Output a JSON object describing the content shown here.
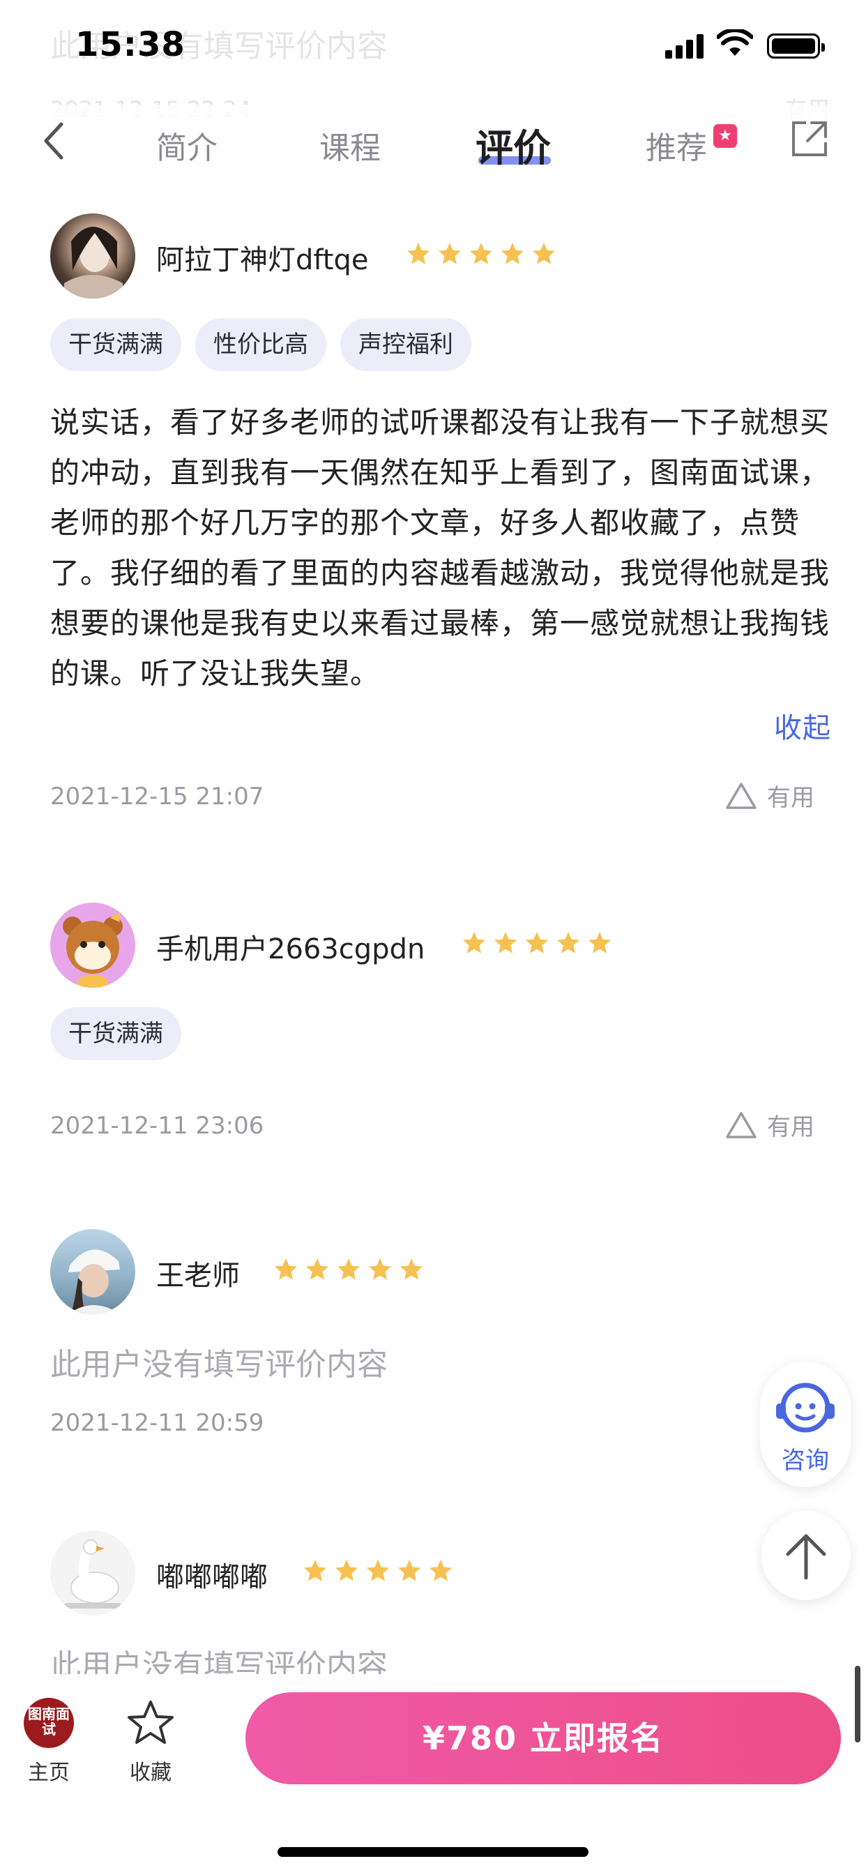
{
  "status_bar": {
    "time": "15:38"
  },
  "background_ghost": {
    "text": "此用户没有填写评价内容",
    "date": "2021-12-15 22:24",
    "useful": "有用"
  },
  "header": {
    "tabs": [
      {
        "label": "简介",
        "active": false
      },
      {
        "label": "课程",
        "active": false
      },
      {
        "label": "评价",
        "active": true
      },
      {
        "label": "推荐",
        "active": false
      }
    ],
    "badge_icon": "star-badge"
  },
  "reviews": [
    {
      "name": "阿拉丁神灯dftqe",
      "rating": 5,
      "tags": [
        "干货满满",
        "性价比高",
        "声控福利"
      ],
      "content": "说实话，看了好多老师的试听课都没有让我有一下子就想买的冲动，直到我有一天偶然在知乎上看到了，图南面试课，老师的那个好几万字的那个文章，好多人都收藏了，点赞了。我仔细的看了里面的内容越看越激动，我觉得他就是我想要的课他是我有史以来看过最棒，第一感觉就想让我掏钱的课。听了没让我失望。",
      "collapse_label": "收起",
      "date": "2021-12-15 21:07",
      "useful_label": "有用"
    },
    {
      "name": "手机用户2663cgpdn",
      "rating": 5,
      "tags": [
        "干货满满"
      ],
      "date": "2021-12-11 23:06",
      "useful_label": "有用"
    },
    {
      "name": "王老师",
      "rating": 5,
      "empty_text": "此用户没有填写评价内容",
      "date": "2021-12-11 20:59"
    },
    {
      "name": "嘟嘟嘟嘟",
      "rating": 5,
      "empty_text": "此用户没有填写评价内容"
    }
  ],
  "floating": {
    "consult_label": "咨询"
  },
  "bottom_bar": {
    "logo_text": "图南面试",
    "home_label": "主页",
    "favorite_label": "收藏",
    "cta_label": "¥780  立即报名"
  },
  "colors": {
    "accent_blue": "#4a67e0",
    "star": "#f6c150",
    "cta_start": "#f05aa8",
    "cta_end": "#ec4e86",
    "tag_bg": "#ecedf8"
  }
}
